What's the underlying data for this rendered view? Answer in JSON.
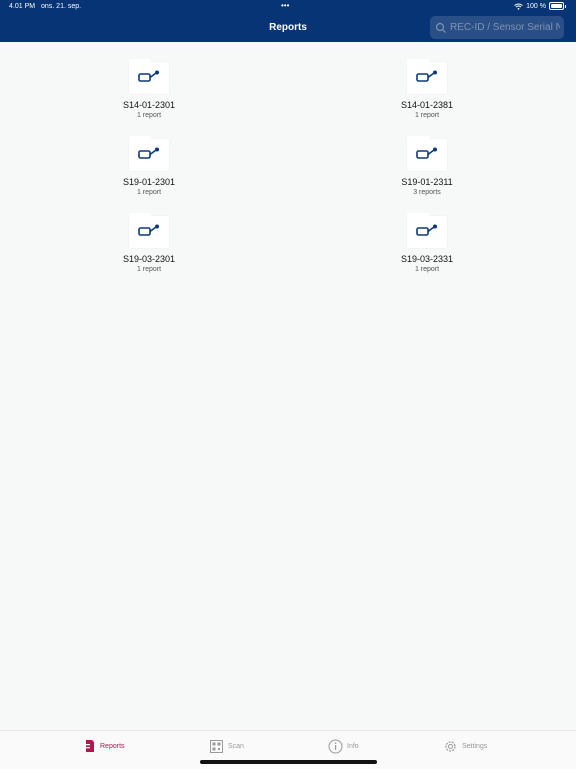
{
  "status_bar": {
    "time": "4.01 PM",
    "date": "ons. 21. sep.",
    "battery": "100 %"
  },
  "header": {
    "title": "Reports",
    "search_placeholder": "REC-ID / Sensor Serial No."
  },
  "reports": [
    {
      "id": "S14-01-2301",
      "count": "1 report"
    },
    {
      "id": "S14-01-2381",
      "count": "1 report"
    },
    {
      "id": "S19-01-2301",
      "count": "1 report"
    },
    {
      "id": "S19-01-2311",
      "count": "3 reports"
    },
    {
      "id": "S19-03-2301",
      "count": "1 report"
    },
    {
      "id": "S19-03-2331",
      "count": "1 report"
    }
  ],
  "tabs": [
    {
      "label": "Reports",
      "icon": "reports-icon",
      "active": true
    },
    {
      "label": "Scan",
      "icon": "qr-scan-icon",
      "active": false
    },
    {
      "label": "Info",
      "icon": "info-icon",
      "active": false
    },
    {
      "label": "Settings",
      "icon": "gear-icon",
      "active": false
    }
  ],
  "colors": {
    "header_bg": "#063474",
    "accent": "#b0174b",
    "icon_blue": "#0b3a7a"
  }
}
